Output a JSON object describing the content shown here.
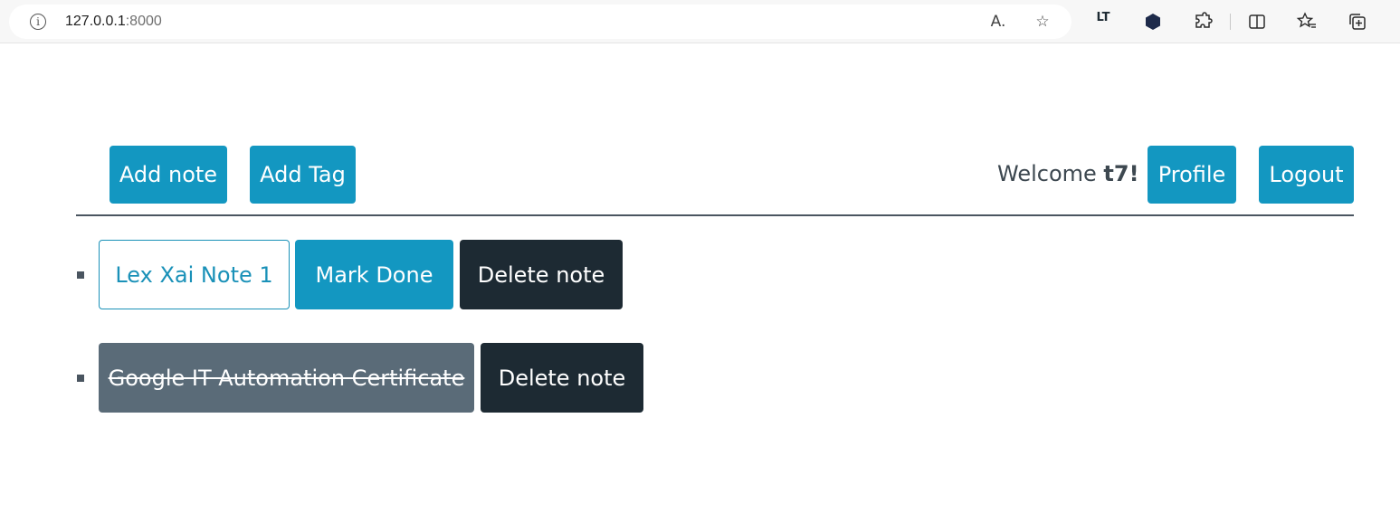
{
  "browser": {
    "url_host": "127.0.0.1",
    "url_port": ":8000",
    "icons": [
      "info-icon",
      "read-aloud-icon",
      "favorite-star-icon",
      "languagetool-icon",
      "extension-hex-icon",
      "extensions-icon",
      "split-screen-icon",
      "favorites-icon",
      "collections-icon"
    ]
  },
  "nav": {
    "add_note": "Add note",
    "add_tag": "Add Tag",
    "welcome_prefix": "Welcome ",
    "username": "t7!",
    "profile": "Profile",
    "logout": "Logout"
  },
  "notes": [
    {
      "title": "Lex Xai Note 1",
      "done": false,
      "mark_done": "Mark Done",
      "delete": "Delete note"
    },
    {
      "title": "Google IT Automation Certificate",
      "done": true,
      "delete": "Delete note"
    }
  ],
  "colors": {
    "primary": "#1397c1",
    "dark": "#1d2a33",
    "muted": "#5a6b78"
  }
}
